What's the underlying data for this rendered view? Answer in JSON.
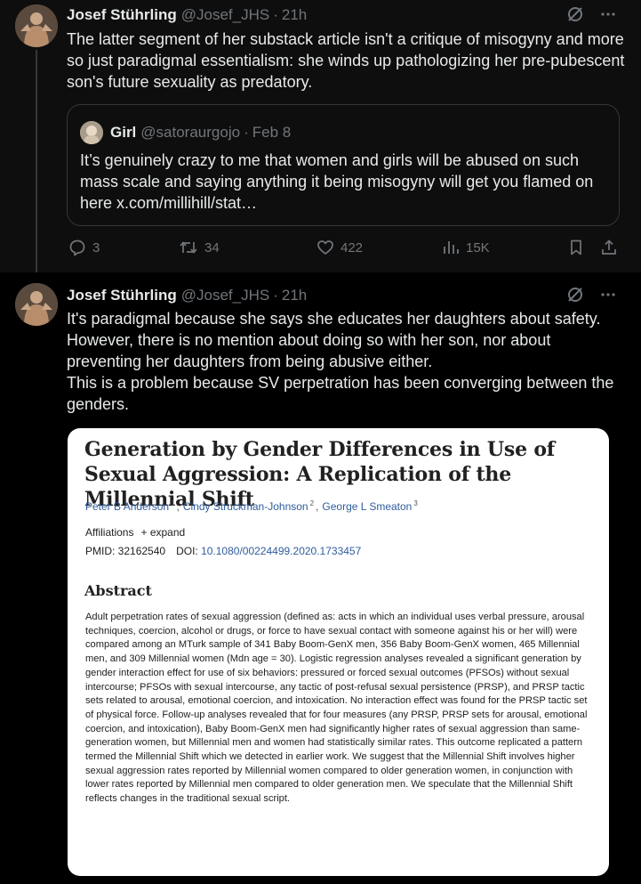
{
  "tweet1": {
    "display_name": "Josef Stührling",
    "handle": "@Josef_JHS",
    "dot": "·",
    "time": "21h",
    "text": "The latter segment of her substack article isn't a critique of misogyny and more so just paradigmal essentialism: she winds up pathologizing her pre-pubescent son's future sexuality as predatory.",
    "quote": {
      "display_name": "Girl",
      "handle": "@satoraurgojo",
      "dot": "·",
      "date": "Feb 8",
      "text": "It’s genuinely crazy to me that women and girls will be abused on such mass scale and saying anything it being misogyny will get you flamed on here x.com/millihill/stat…"
    },
    "actions": {
      "replies": "3",
      "reposts": "34",
      "likes": "422",
      "views": "15K"
    }
  },
  "tweet2": {
    "display_name": "Josef Stührling",
    "handle": "@Josef_JHS",
    "dot": "·",
    "time": "21h",
    "text": "It's paradigmal because she says she educates her daughters about safety. However, there is no mention about doing so with her son, nor about preventing her daughters from being abusive either.\nThis is a problem because SV perpetration has been converging between the genders.",
    "image": {
      "title": "Generation by Gender Differences in Use of Sexual Aggression: A Replication of the Millennial Shift",
      "authors": [
        {
          "name": "Peter B Anderson",
          "sup": "1"
        },
        {
          "name": "Cindy Struckman-Johnson",
          "sup": "2"
        },
        {
          "name": "George L Smeaton",
          "sup": "3"
        }
      ],
      "affiliations_label": "Affiliations",
      "expand_label": "+ expand",
      "pmid_label": "PMID: 32162540",
      "doi_label": "DOI:",
      "doi": "10.1080/00224499.2020.1733457",
      "abstract_heading": "Abstract",
      "abstract": "Adult perpetration rates of sexual aggression (defined as: acts in which an individual uses verbal pressure, arousal techniques, coercion, alcohol or drugs, or force to have sexual contact with someone against his or her will) were compared among an MTurk sample of 341 Baby Boom-GenX men, 356 Baby Boom-GenX women, 465 Millennial men, and 309 Millennial women (Mdn age = 30). Logistic regression analyses revealed a significant generation by gender interaction effect for use of six behaviors: pressured or forced sexual outcomes (PFSOs) without sexual intercourse; PFSOs with sexual intercourse, any tactic of post-refusal sexual persistence (PRSP), and PRSP tactic sets related to arousal, emotional coercion, and intoxication. No interaction effect was found for the PRSP tactic set of physical force. Follow-up analyses revealed that for four measures (any PRSP, PRSP sets for arousal, emotional coercion, and intoxication), Baby Boom-GenX men had significantly higher rates of sexual aggression than same-generation women, but Millennial men and women had statistically similar rates. This outcome replicated a pattern termed the Millennial Shift which we detected in earlier work. We suggest that the Millennial Shift involves higher sexual aggression rates reported by Millennial women compared to older generation women, in conjunction with lower rates reported by Millennial men compared to older generation men. We speculate that the Millennial Shift reflects changes in the traditional sexual script."
    }
  },
  "icons": {
    "grok": "grok-icon",
    "more": "more-icon",
    "reply": "reply-icon",
    "repost": "repost-icon",
    "like": "like-icon",
    "views": "views-icon",
    "bookmark": "bookmark-icon",
    "share": "share-icon"
  },
  "colors": {
    "background": "#000000",
    "tweet1_background": "#0e0e0e",
    "text": "#e7e9ea",
    "secondary_text": "#71767b",
    "border": "#333639",
    "link_blue": "#2f5c9c"
  }
}
